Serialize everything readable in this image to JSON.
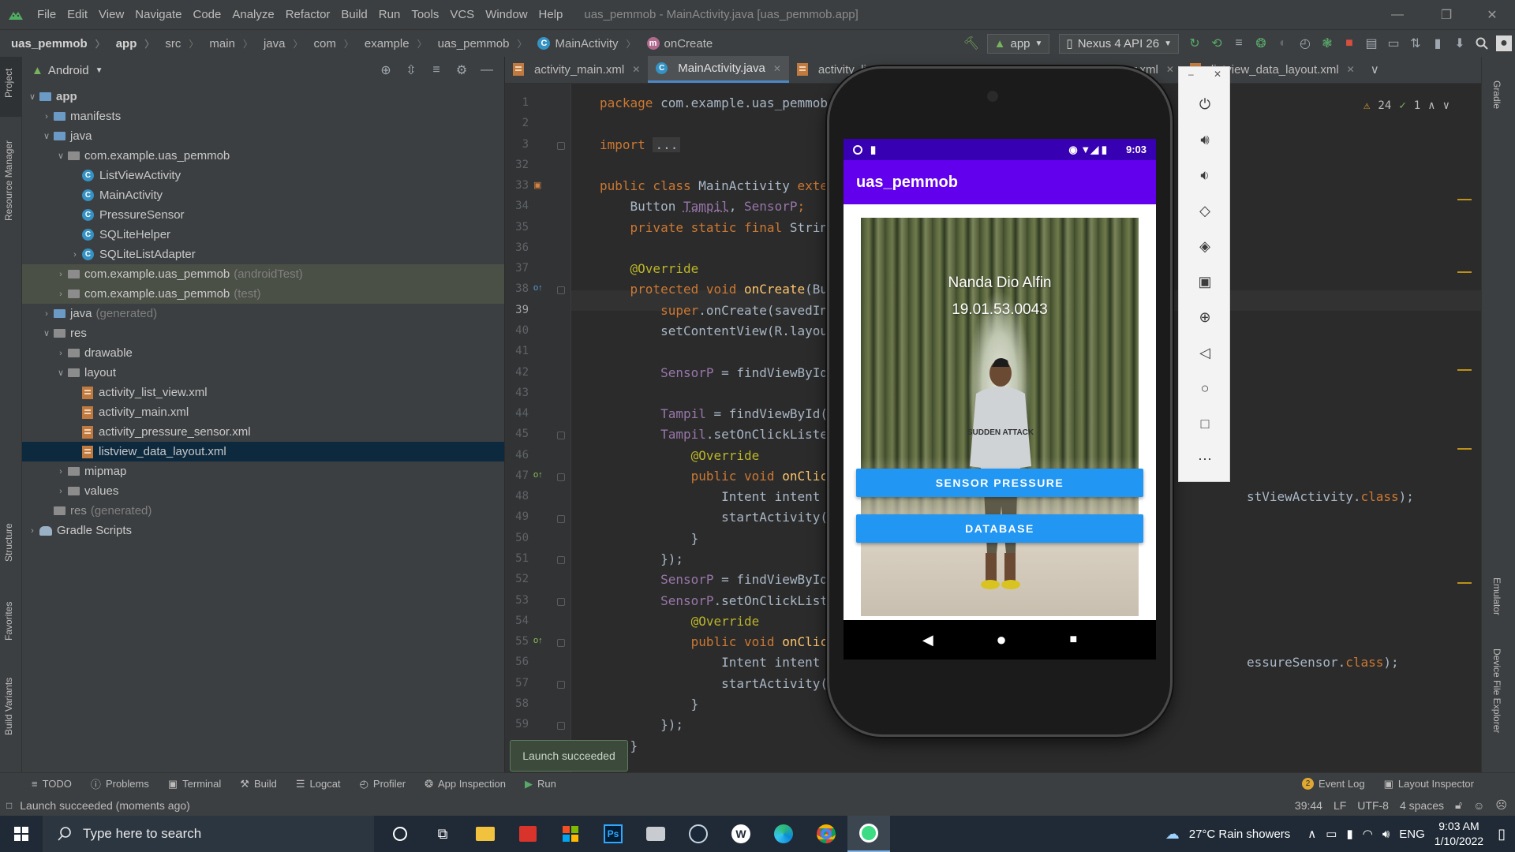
{
  "window": {
    "title": "uas_pemmob - MainActivity.java [uas_pemmob.app]",
    "menu": [
      "File",
      "Edit",
      "View",
      "Navigate",
      "Code",
      "Analyze",
      "Refactor",
      "Build",
      "Run",
      "Tools",
      "VCS",
      "Window",
      "Help"
    ]
  },
  "breadcrumb": [
    "uas_pemmob",
    "app",
    "src",
    "main",
    "java",
    "com",
    "example",
    "uas_pemmob",
    "MainActivity",
    "onCreate"
  ],
  "toolbar": {
    "run_config": "app",
    "device": "Nexus 4 API 26"
  },
  "left_tabs": [
    "Project",
    "Resource Manager",
    "Structure",
    "Favorites",
    "Build Variants"
  ],
  "right_tabs": [
    "Gradle",
    "Emulator",
    "Device File Explorer"
  ],
  "project": {
    "view_mode": "Android",
    "tree": [
      {
        "label": "app",
        "depth": 0,
        "arrow": "v",
        "icon": "folder"
      },
      {
        "label": "manifests",
        "depth": 1,
        "arrow": ">",
        "icon": "folder"
      },
      {
        "label": "java",
        "depth": 1,
        "arrow": "v",
        "icon": "folder"
      },
      {
        "label": "com.example.uas_pemmob",
        "depth": 2,
        "arrow": "v",
        "icon": "pkg"
      },
      {
        "label": "ListViewActivity",
        "depth": 3,
        "arrow": "",
        "icon": "class"
      },
      {
        "label": "MainActivity",
        "depth": 3,
        "arrow": "",
        "icon": "class"
      },
      {
        "label": "PressureSensor",
        "depth": 3,
        "arrow": "",
        "icon": "class"
      },
      {
        "label": "SQLiteHelper",
        "depth": 3,
        "arrow": "",
        "icon": "class"
      },
      {
        "label": "SQLiteListAdapter",
        "depth": 3,
        "arrow": ">",
        "icon": "class"
      },
      {
        "label": "com.example.uas_pemmob",
        "suffix": "(androidTest)",
        "depth": 2,
        "arrow": ">",
        "icon": "pkg"
      },
      {
        "label": "com.example.uas_pemmob",
        "suffix": "(test)",
        "depth": 2,
        "arrow": ">",
        "icon": "pkg"
      },
      {
        "label": "java",
        "suffix": "(generated)",
        "depth": 1,
        "arrow": ">",
        "icon": "folder"
      },
      {
        "label": "res",
        "depth": 1,
        "arrow": "v",
        "icon": "folder"
      },
      {
        "label": "drawable",
        "depth": 2,
        "arrow": ">",
        "icon": "pkg"
      },
      {
        "label": "layout",
        "depth": 2,
        "arrow": "v",
        "icon": "pkg"
      },
      {
        "label": "activity_list_view.xml",
        "depth": 3,
        "arrow": "",
        "icon": "xml"
      },
      {
        "label": "activity_main.xml",
        "depth": 3,
        "arrow": "",
        "icon": "xml"
      },
      {
        "label": "activity_pressure_sensor.xml",
        "depth": 3,
        "arrow": "",
        "icon": "xml"
      },
      {
        "label": "listview_data_layout.xml",
        "depth": 3,
        "arrow": "",
        "icon": "xml"
      },
      {
        "label": "mipmap",
        "depth": 2,
        "arrow": ">",
        "icon": "pkg"
      },
      {
        "label": "values",
        "depth": 2,
        "arrow": ">",
        "icon": "pkg"
      },
      {
        "label": "res",
        "suffix": "(generated)",
        "depth": 1,
        "arrow": "",
        "icon": "grey"
      },
      {
        "label": "Gradle Scripts",
        "depth": 0,
        "arrow": ">",
        "icon": "gradle"
      }
    ]
  },
  "editor": {
    "tabs": [
      {
        "label": "activity_main.xml",
        "active": false
      },
      {
        "label": "MainActivity.java",
        "active": true
      },
      {
        "label": "activity_list_vi...",
        "active": false
      },
      {
        "label": "activity_pr...",
        "active": false
      },
      {
        "label": "sor.xml",
        "active": false
      },
      {
        "label": "listview_data_layout.xml",
        "active": false
      }
    ],
    "warnings": "24",
    "weak_warnings": "1",
    "line_numbers": [
      "1",
      "2",
      "3",
      "32",
      "33",
      "34",
      "35",
      "36",
      "37",
      "38",
      "39",
      "40",
      "41",
      "42",
      "43",
      "44",
      "45",
      "46",
      "47",
      "48",
      "49",
      "50",
      "51",
      "52",
      "53",
      "54",
      "55",
      "56",
      "57",
      "58",
      "59",
      "60"
    ],
    "code": {
      "l1_kw": "package",
      "l1": " com.example.uas_pemmob;",
      "l3_kw": "import",
      "l3": "...",
      "l33_kw": "public class",
      "l33": " MainActivity ",
      "l33_kw2": "extends",
      "l34": "    Button ",
      "l34_f1": "Tampil",
      "l34_sep": ", ",
      "l34_f2": "SensorP",
      "l34_end": ";",
      "l35_kw": "    private static final",
      "l35": " String ",
      "l35_f": "L",
      "l37": "    @Override",
      "l38_kw": "    protected void",
      "l38_fn": " onCreate",
      "l38": "(Bundl",
      "l39_kw": "        super",
      "l39": ".onCreate(savedInsta",
      "l40": "        setContentView(R.layout.",
      "l40_f": "a",
      "l42_f": "        SensorP",
      "l42": " = findViewById(R.",
      "l44_f": "        Tampil",
      "l44": " = findViewById(R.i",
      "l45_f": "        Tampil",
      "l45": ".setOnClickListener",
      "l46": "            @Override",
      "l47_kw": "            public void",
      "l47_fn": " onClick",
      "l47": "(V",
      "l48": "                Intent intent = ",
      "l48_kw": "n",
      "l48_tail": "stViewActivity.",
      "l48_tail_kw": "class",
      "l48_tail_end": ");",
      "l49": "                startActivity(int",
      "l50": "            }",
      "l51": "        });",
      "l52_f": "        SensorP",
      "l52": " = findViewById(R.",
      "l53_f": "        SensorP",
      "l53": ".setOnClickListene",
      "l54": "            @Override",
      "l55_kw": "            public void",
      "l55_fn": " onClick",
      "l55": "(V",
      "l56": "                Intent intent = ",
      "l56_kw": "n",
      "l56_tail": "essureSensor.",
      "l56_tail_kw": "class",
      "l56_tail_end": ");",
      "l57": "                startActivity(int",
      "l58": "            }",
      "l59": "        });",
      "l60": "    }"
    }
  },
  "emulator": {
    "status_time": "9:03",
    "app_title": "uas_pemmob",
    "name": "Nanda Dio Alfin",
    "id": "19.01.53.0043",
    "shirt_text": "SUDDEN ATTACK",
    "btn_sensor": "SENSOR PRESSURE",
    "btn_database": "DATABASE"
  },
  "tooltip": "Launch succeeded",
  "bottom_tools": [
    "TODO",
    "Problems",
    "Terminal",
    "Build",
    "Logcat",
    "Profiler",
    "App Inspection",
    "Run"
  ],
  "bottom_right_tools": {
    "event_log_count": "2",
    "event_log": "Event Log",
    "layout_inspector": "Layout Inspector"
  },
  "status": {
    "message": "Launch succeeded (moments ago)",
    "position": "39:44",
    "line_sep": "LF",
    "encoding": "UTF-8",
    "indent": "4 spaces"
  },
  "taskbar": {
    "search_placeholder": "Type here to search",
    "weather": "27°C  Rain showers",
    "lang": "ENG",
    "time": "9:03 AM",
    "date": "1/10/2022"
  }
}
